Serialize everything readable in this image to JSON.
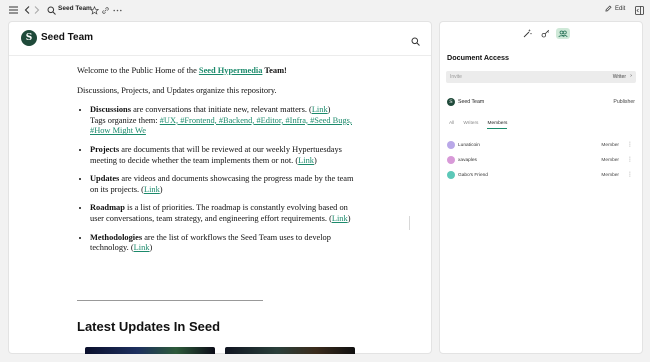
{
  "topbar": {
    "title": "Seed Team",
    "edit_label": "Edit"
  },
  "header": {
    "logo_letter": "S",
    "title": "Seed Team"
  },
  "document": {
    "welcome_prefix": "Welcome to the Public Home of the ",
    "welcome_link": "Seed Hypermedia",
    "welcome_suffix": " Team!",
    "intro": "Discussions, Projects, and Updates organize this repository.",
    "items": [
      {
        "term": "Discussions",
        "text": " are conversations that initiate new, relevant matters. (",
        "link": "Link",
        "after_link": ")",
        "tags_prefix": "Tags organize them: ",
        "tags": "#UX, #Frontend, #Backend, #Editor, #Infra, #Seed Bugs, #How Might We"
      },
      {
        "term": "Projects",
        "text": " are documents that will be reviewed at our weekly Hypertuesdays meeting to decide whether the team implements them or not. (",
        "link": "Link",
        "after_link": ")"
      },
      {
        "term": "Updates",
        "text": " are videos and documents showcasing the progress made by the team on its projects. (",
        "link": "Link",
        "after_link": ")"
      },
      {
        "term": "Roadmap",
        "text": " is a list of priorities. The roadmap is constantly evolving based on user conversations, team strategy, and engineering effort requirements. (",
        "link": "Link",
        "after_link": ")"
      },
      {
        "term": "Methodologies",
        "text": " are the list of workflows the Seed Team uses to develop technology. (",
        "link": "Link",
        "after_link": ")"
      }
    ],
    "latest_title": "Latest Updates In Seed"
  },
  "side_panel": {
    "title": "Document Access",
    "invite_placeholder": "Invite",
    "invite_role": "Writer",
    "publisher": {
      "avatar_letter": "S",
      "name": "Seed Team",
      "role": "Publisher"
    },
    "tabs": [
      {
        "label": "All"
      },
      {
        "label": "Writers"
      },
      {
        "label": "Members"
      }
    ],
    "active_tab": "Members",
    "members": [
      {
        "name": "Lunaticoin",
        "role": "Member",
        "color": "#b9a8e8"
      },
      {
        "name": "xavaples",
        "role": "Member",
        "color": "#d89ad8"
      },
      {
        "name": "Gabo's Friend",
        "role": "Member",
        "color": "#5cc8b8"
      }
    ]
  },
  "colors": {
    "accent": "#1b8a6b",
    "active_tab_bg": "#cfe9d8",
    "logo": "#1f4a3a"
  }
}
